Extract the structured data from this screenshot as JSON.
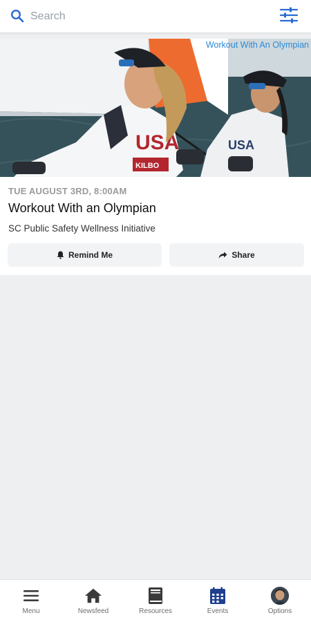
{
  "search": {
    "placeholder": "Search",
    "value": ""
  },
  "event": {
    "banner_text": "Workout With An Olympian",
    "date": "TUE AUGUST 3RD, 8:00AM",
    "title": "Workout With an Olympian",
    "organizer": "SC Public Safety Wellness Initiative",
    "remind_label": "Remind Me",
    "share_label": "Share"
  },
  "nav": {
    "items": [
      {
        "label": "Menu",
        "icon": "menu-icon"
      },
      {
        "label": "Newsfeed",
        "icon": "home-icon"
      },
      {
        "label": "Resources",
        "icon": "book-icon"
      },
      {
        "label": "Events",
        "icon": "calendar-icon"
      },
      {
        "label": "Options",
        "icon": "avatar"
      }
    ],
    "active": "Events"
  },
  "colors": {
    "accent": "#2a6bd1",
    "active_nav": "#1f3f8f",
    "inactive_nav": "#3a3a3a",
    "banner_text": "#2a8ad8"
  }
}
